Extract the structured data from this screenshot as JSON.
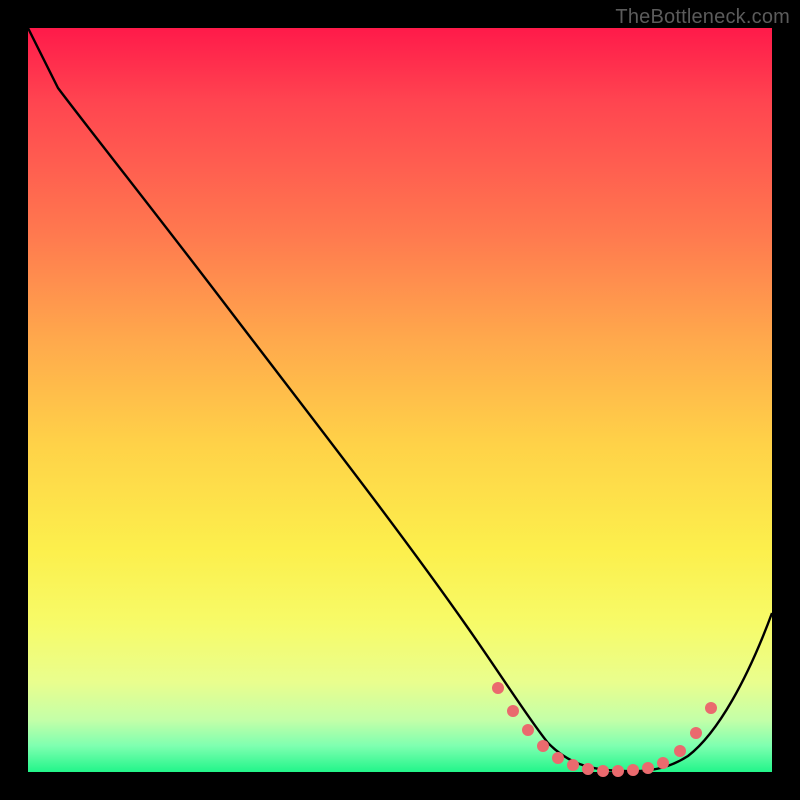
{
  "watermark": {
    "text": "TheBottleneck.com"
  },
  "chart_data": {
    "type": "line",
    "title": "",
    "xlabel": "",
    "ylabel": "",
    "xlim": [
      0,
      100
    ],
    "ylim": [
      0,
      100
    ],
    "grid": false,
    "legend": false,
    "background_gradient": {
      "direction": "vertical",
      "stops": [
        {
          "at": 0,
          "color": "#ff1a4a"
        },
        {
          "at": 10,
          "color": "#ff4550"
        },
        {
          "at": 28,
          "color": "#ff7a4f"
        },
        {
          "at": 42,
          "color": "#ffa94c"
        },
        {
          "at": 56,
          "color": "#ffd248"
        },
        {
          "at": 70,
          "color": "#fcef4c"
        },
        {
          "at": 80,
          "color": "#f7fb68"
        },
        {
          "at": 88,
          "color": "#e9fe8e"
        },
        {
          "at": 93,
          "color": "#c4ffa8"
        },
        {
          "at": 96.5,
          "color": "#7effb0"
        },
        {
          "at": 100,
          "color": "#22f58a"
        }
      ]
    },
    "series": [
      {
        "name": "curve",
        "color": "#000000",
        "x": [
          0,
          4,
          10,
          20,
          30,
          40,
          50,
          58,
          63,
          66,
          70,
          75,
          80,
          84,
          88,
          92,
          96,
          100
        ],
        "y": [
          100,
          96,
          90,
          78,
          65,
          52,
          39,
          28,
          20,
          13,
          6,
          1.5,
          0.5,
          0.5,
          1.5,
          6,
          14,
          25
        ]
      }
    ],
    "markers": [
      {
        "name": "flat-region-dots",
        "color": "#ea6a6e",
        "radius_px": 6,
        "points": [
          {
            "x": 63,
            "y": 20
          },
          {
            "x": 66,
            "y": 13
          },
          {
            "x": 68,
            "y": 8
          },
          {
            "x": 70,
            "y": 5
          },
          {
            "x": 72,
            "y": 3
          },
          {
            "x": 74,
            "y": 1.5
          },
          {
            "x": 76,
            "y": 1
          },
          {
            "x": 78,
            "y": 0.7
          },
          {
            "x": 80,
            "y": 0.5
          },
          {
            "x": 82,
            "y": 0.6
          },
          {
            "x": 84,
            "y": 1
          },
          {
            "x": 86,
            "y": 2
          },
          {
            "x": 88,
            "y": 4
          },
          {
            "x": 90,
            "y": 8
          },
          {
            "x": 92,
            "y": 14
          }
        ]
      }
    ]
  }
}
